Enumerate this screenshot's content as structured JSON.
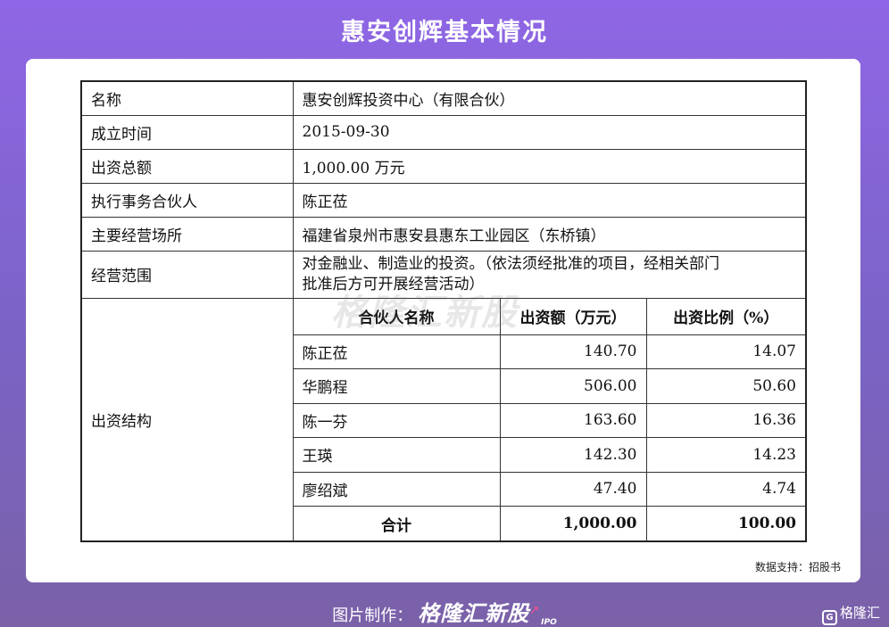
{
  "header": {
    "title": "惠安创辉基本情况"
  },
  "table": {
    "rows": [
      {
        "key": "名称",
        "value": "惠安创辉投资中心（有限合伙）"
      },
      {
        "key": "成立时间",
        "value": "2015-09-30"
      },
      {
        "key": "出资总额",
        "value": "1,000.00 万元"
      },
      {
        "key": "执行事务合伙人",
        "value": "陈正莅"
      },
      {
        "key": "主要经营场所",
        "value": "福建省泉州市惠安县惠东工业园区（东桥镇）"
      },
      {
        "key": "经营范围",
        "value_line1": "对金融业、制造业的投资。（依法须经批准的项目，经相关部门",
        "value_line2": "批准后方可开展经营活动）"
      }
    ],
    "structure_label": "出资结构",
    "sub_headers": [
      "合伙人名称",
      "出资额（万元）",
      "出资比例（%）"
    ],
    "partners": [
      {
        "name": "陈正莅",
        "amount": "140.70",
        "ratio": "14.07"
      },
      {
        "name": "华鹏程",
        "amount": "506.00",
        "ratio": "50.60"
      },
      {
        "name": "陈一芬",
        "amount": "163.60",
        "ratio": "16.36"
      },
      {
        "name": "王瑛",
        "amount": "142.30",
        "ratio": "14.23"
      },
      {
        "name": "廖绍斌",
        "amount": "47.40",
        "ratio": "4.74"
      }
    ],
    "total": {
      "label": "合计",
      "amount": "1,000.00",
      "ratio": "100.00"
    }
  },
  "watermark": "格隆汇新股",
  "source": "数据支持：招股书",
  "footer": {
    "prefix": "图片制作：",
    "brand": "格隆汇新股",
    "ipo": "IPO"
  },
  "corner_logo": {
    "text": "格隆汇",
    "mark": "G"
  }
}
